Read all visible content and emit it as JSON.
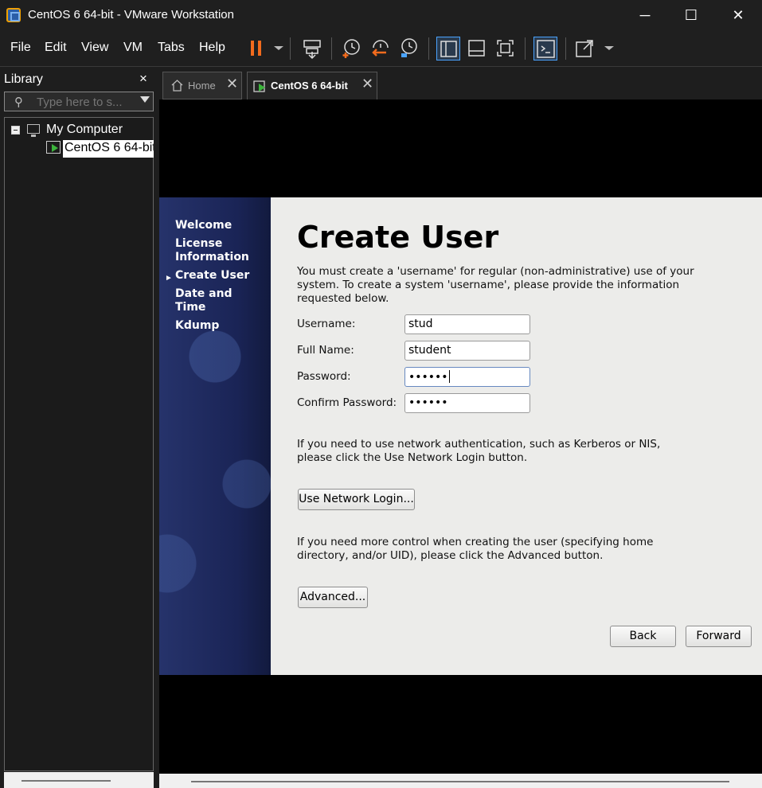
{
  "window": {
    "title": "CentOS 6 64-bit - VMware Workstation",
    "minimize": "─",
    "maximize": "☐",
    "close": "✕"
  },
  "menu": [
    "File",
    "Edit",
    "View",
    "VM",
    "Tabs",
    "Help"
  ],
  "toolbar": {
    "icons": [
      "pause-icon",
      "send-ctrl-alt-del-icon",
      "snapshot-icon",
      "revert-snapshot-icon",
      "snapshot-manager-icon",
      "show-library-icon",
      "thumbnail-bar-icon",
      "fit-guest-icon",
      "console-view-icon",
      "full-screen-icon"
    ],
    "accent_color": "#f26b1d"
  },
  "library": {
    "title": "Library",
    "close": "×",
    "search_placeholder": "Type here to s...",
    "tree": {
      "root": "My Computer",
      "vm": "CentOS 6 64-bit"
    }
  },
  "tabs": [
    {
      "label": "Home",
      "close": "✕",
      "icon": "home-icon"
    },
    {
      "label": "CentOS 6 64-bit",
      "close": "✕",
      "icon": "vm-play-icon",
      "active": true
    }
  ],
  "installer": {
    "steps": [
      "Welcome",
      "License\nInformation",
      "Create User",
      "Date and\nTime",
      "Kdump"
    ],
    "current_step": "Create User",
    "title": "Create User",
    "intro": "You must create a 'username' for regular (non-administrative) use of your\nsystem.  To create a system 'username', please provide the information\nrequested below.",
    "fields": {
      "username_label": "Username:",
      "username_value": "stud",
      "fullname_label": "Full Name:",
      "fullname_value": "student",
      "password_label": "Password:",
      "password_value": "••••••",
      "confirm_label": "Confirm Password:",
      "confirm_value": "••••••"
    },
    "network_text": "If you need to use network authentication, such as Kerberos or NIS,\nplease click the Use Network Login button.",
    "network_button": "Use Network Login...",
    "advanced_text": "If you need more control when creating the user (specifying home\ndirectory, and/or UID), please click the Advanced button.",
    "advanced_button": "Advanced...",
    "back_button": "Back",
    "forward_button": "Forward"
  }
}
